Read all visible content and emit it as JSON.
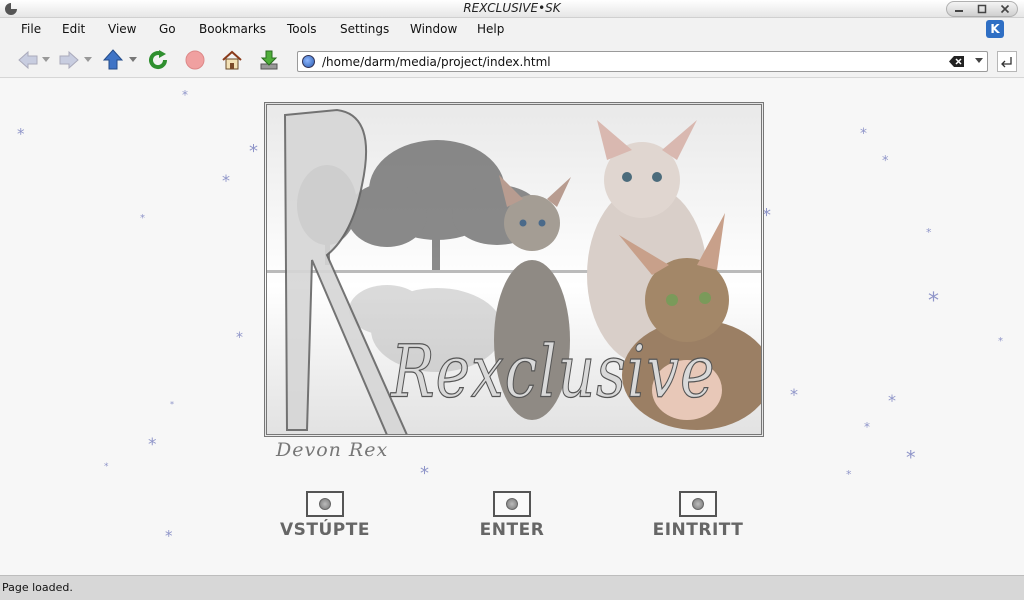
{
  "window": {
    "title": "REXCLUSIVE•SK"
  },
  "menubar": {
    "items": [
      "File",
      "Edit",
      "View",
      "Go",
      "Bookmarks",
      "Tools",
      "Settings",
      "Window",
      "Help"
    ]
  },
  "toolbar": {
    "buttons": [
      "back-icon",
      "forward-icon",
      "up-icon",
      "reload-icon",
      "stop-icon",
      "home-icon",
      "download-icon"
    ],
    "address": "/home/darm/media/project/index.html"
  },
  "content": {
    "banner_text": "Rexclusive",
    "banner_subtext": "Devon Rex",
    "links": [
      "VSTÚPTE",
      "ENTER",
      "EINTRITT"
    ]
  },
  "statusbar": {
    "text": "Page loaded."
  },
  "colors": {
    "snow": "#8f95c9",
    "link_text": "#666666"
  }
}
